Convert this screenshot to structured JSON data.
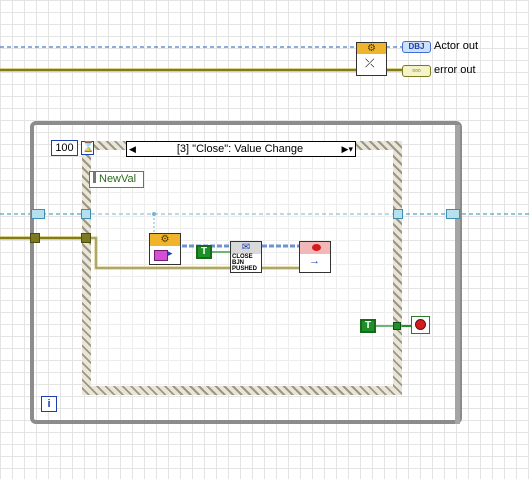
{
  "event_structure": {
    "timeout_constant": "100",
    "hourglass_icon": "hourglass-icon",
    "case_label": "[3] \"Close\": Value Change",
    "prev_case_icon": "triangle-left-icon",
    "next_case_icon": "triangle-right-dropdown-icon",
    "event_data_node": "NewVal"
  },
  "outputs": {
    "actor_label": "Actor out",
    "error_label": "error out",
    "actor_indicator_text": "DBJ",
    "error_indicator_text": "▫▫▫"
  },
  "nodes": {
    "true_constant_1": "T",
    "true_constant_2": "T",
    "close_button_text": "CLOSE BJN PUSHED",
    "iteration_terminal": "i"
  },
  "icons": {
    "read_self": "gear-read-self-icon",
    "send_message": "gear-send-message-icon",
    "close_button": "close-button-message-icon",
    "stop_actor": "stop-actor-message-icon",
    "stop_terminal": "stop-sign-icon"
  },
  "colors": {
    "class_wire": "#1d5bb8",
    "error_wire": "#b8a620",
    "tunnel_blue": "#b6e0ee",
    "loop_border": "#8c8c8c",
    "event_border": "#ccc7b4",
    "boolean_green": "#1f8f2a",
    "stop_red": "#d41c1c"
  }
}
